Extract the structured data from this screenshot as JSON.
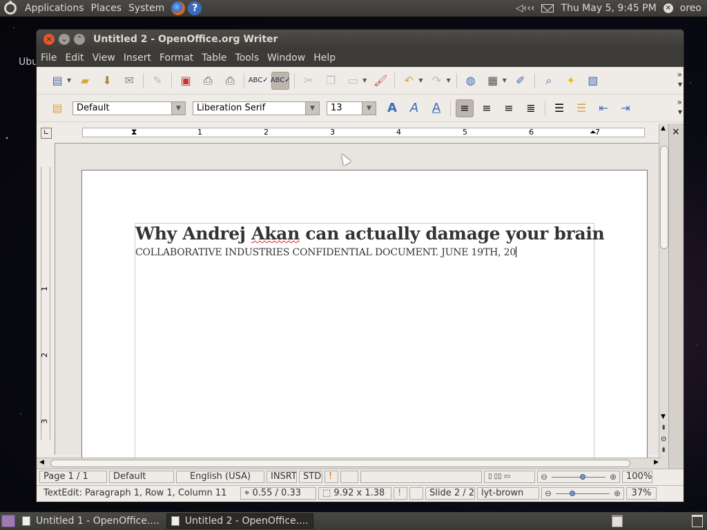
{
  "top_panel": {
    "menus": [
      "Applications",
      "Places",
      "System"
    ],
    "clock": "Thu May  5,  9:45 PM",
    "volume": "◁‹‹‹",
    "user": "oreo"
  },
  "desktop_text": "Ubu",
  "window": {
    "title": "Untitled 2 - OpenOffice.org Writer",
    "menu": [
      "File",
      "Edit",
      "View",
      "Insert",
      "Format",
      "Table",
      "Tools",
      "Window",
      "Help"
    ]
  },
  "formatting": {
    "style": "Default",
    "font": "Liberation Serif",
    "size": "13"
  },
  "ruler": {
    "h_numbers": [
      "1",
      "2",
      "3",
      "4",
      "5",
      "6",
      "7"
    ],
    "v_numbers": [
      "1",
      "2",
      "3"
    ]
  },
  "document": {
    "title_pre": "Why Andrej ",
    "title_misspelled": "Akan",
    "title_post": " can actually damage your brain",
    "subtitle": "COLLABORATIVE INDUSTRIES CONFIDENTIAL DOCUMENT. JUNE 19TH, 20"
  },
  "status1": {
    "page": "Page 1 / 1",
    "style": "Default",
    "language": "English (USA)",
    "mode": "INSRT",
    "selection": "STD",
    "zoom": "100%",
    "zoom_fraction": 0.56
  },
  "status2": {
    "edit": "TextEdit: Paragraph 1, Row 1, Column 11",
    "position": "0.55 / 0.33",
    "size": "9.92 x 1.38",
    "slide": "Slide 2 / 2",
    "layout": "lyt-brown",
    "zoom": "37%",
    "zoom_fraction": 0.3
  },
  "taskbar": {
    "tasks": [
      "Untitled 1 - OpenOffice....",
      "Untitled 2 - OpenOffice...."
    ]
  }
}
